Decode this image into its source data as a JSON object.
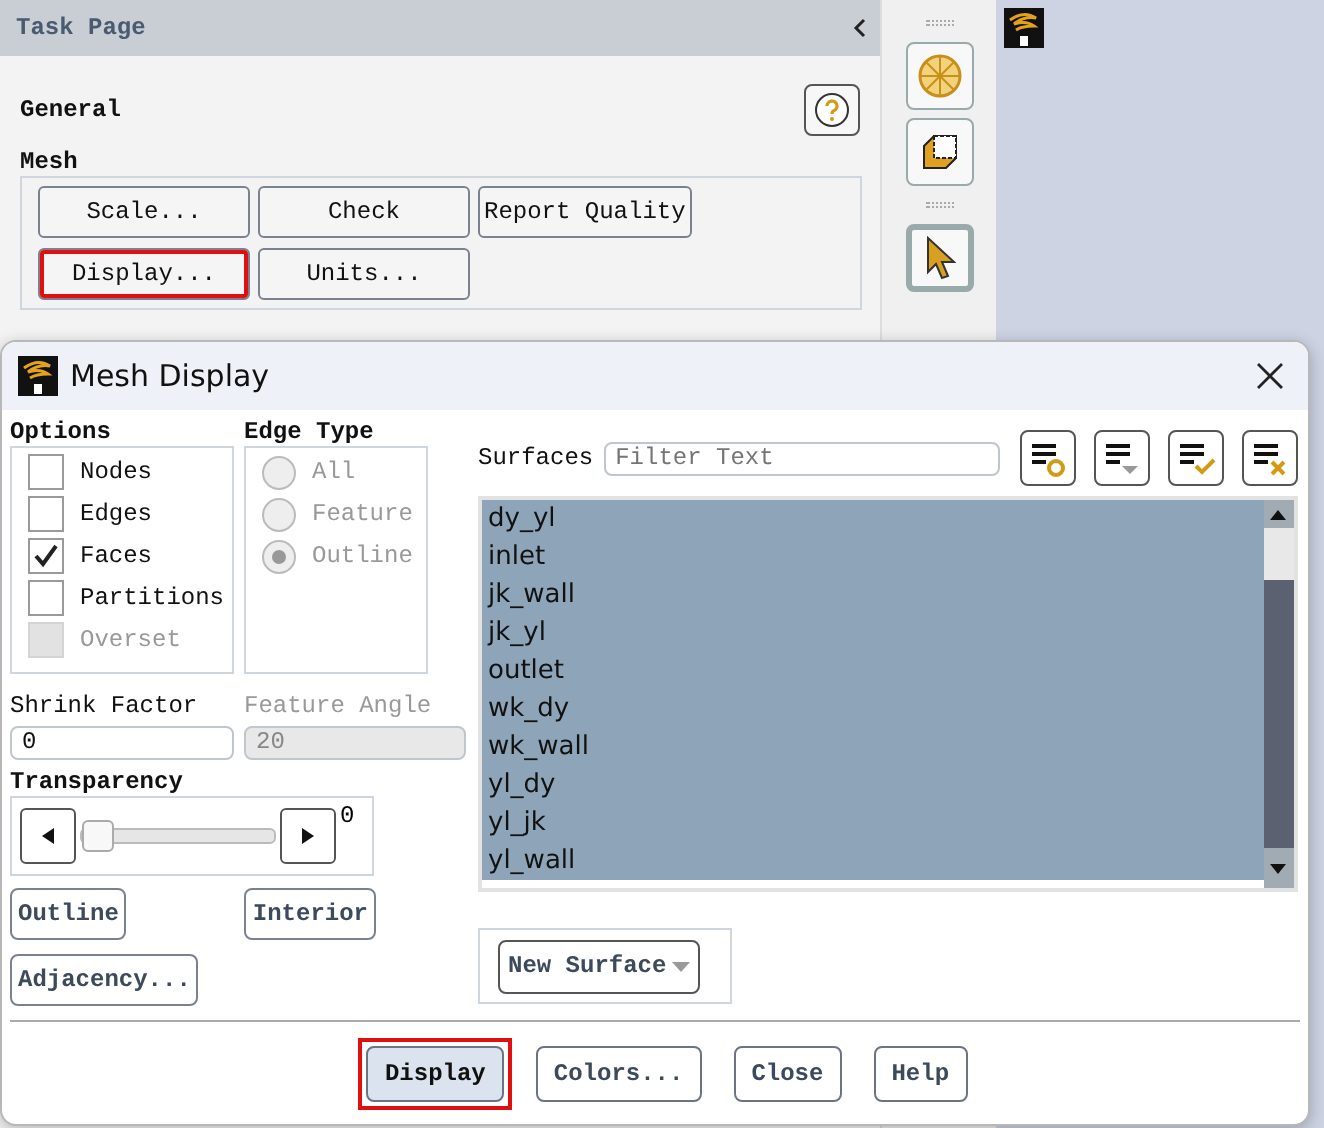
{
  "task_page": {
    "title": "Task Page",
    "section": "General",
    "group": "Mesh",
    "buttons": [
      {
        "label": "Scale...",
        "highlighted": false
      },
      {
        "label": "Check",
        "highlighted": false
      },
      {
        "label": "Report Quality",
        "highlighted": false
      },
      {
        "label": "Display...",
        "highlighted": true
      },
      {
        "label": "Units...",
        "highlighted": false
      }
    ]
  },
  "dialog": {
    "title": "Mesh Display",
    "options": {
      "title": "Options",
      "items": [
        {
          "label": "Nodes",
          "checked": false,
          "disabled": false
        },
        {
          "label": "Edges",
          "checked": false,
          "disabled": false
        },
        {
          "label": "Faces",
          "checked": true,
          "disabled": false
        },
        {
          "label": "Partitions",
          "checked": false,
          "disabled": false
        },
        {
          "label": "Overset",
          "checked": false,
          "disabled": true
        }
      ]
    },
    "edge_type": {
      "title": "Edge Type",
      "items": [
        {
          "label": "All",
          "selected": false,
          "disabled": true
        },
        {
          "label": "Feature",
          "selected": false,
          "disabled": true
        },
        {
          "label": "Outline",
          "selected": true,
          "disabled": true
        }
      ]
    },
    "shrink_factor": {
      "label": "Shrink Factor",
      "value": "0"
    },
    "feature_angle": {
      "label": "Feature Angle",
      "value": "20",
      "disabled": true
    },
    "transparency": {
      "label": "Transparency",
      "level": 0,
      "reading": "0"
    },
    "buttons": [
      {
        "label": "Outline"
      },
      {
        "label": "Interior"
      },
      {
        "label": "Adjacency..."
      }
    ],
    "surfaces": {
      "label": "Surfaces",
      "placeholder": "Filter Text",
      "items": [
        {
          "label": "dy_yl",
          "selected": true
        },
        {
          "label": "inlet",
          "selected": true
        },
        {
          "label": "jk_wall",
          "selected": true
        },
        {
          "label": "jk_yl",
          "selected": true
        },
        {
          "label": "outlet",
          "selected": true
        },
        {
          "label": "wk_dy",
          "selected": true
        },
        {
          "label": "wk_wall",
          "selected": true
        },
        {
          "label": "yl_dy",
          "selected": true
        },
        {
          "label": "yl_jk",
          "selected": true
        },
        {
          "label": "yl_wall",
          "selected": true
        }
      ]
    },
    "new_surface": "New Surface",
    "footer_buttons": [
      {
        "label": "Display",
        "highlighted": true,
        "default": true
      },
      {
        "label": "Colors...",
        "highlighted": false,
        "default": false
      },
      {
        "label": "Close",
        "highlighted": false,
        "default": false
      },
      {
        "label": "Help",
        "highlighted": false,
        "default": false
      }
    ]
  }
}
